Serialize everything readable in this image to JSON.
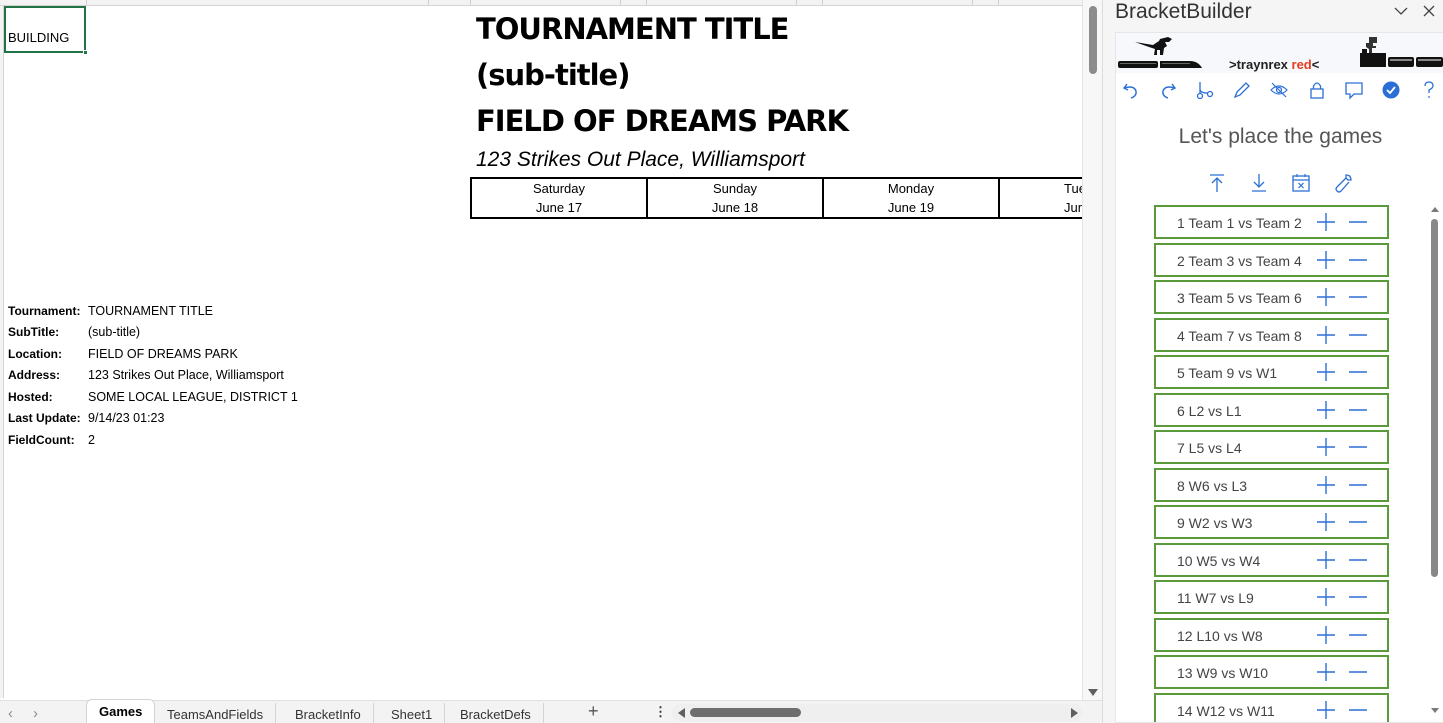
{
  "sheet": {
    "selected_cell_value": "BUILDING",
    "titles": {
      "tournament": "TOURNAMENT TITLE",
      "subtitle": "(sub-title)",
      "location": "FIELD OF DREAMS PARK",
      "address": "123 Strikes Out Place, Williamsport"
    },
    "days": [
      {
        "day": "Saturday",
        "date": "June 17"
      },
      {
        "day": "Sunday",
        "date": "June 18"
      },
      {
        "day": "Monday",
        "date": "June 19"
      },
      {
        "day": "Tue",
        "date": "Jur"
      }
    ],
    "info": [
      {
        "label": "Tournament:",
        "value": "TOURNAMENT TITLE"
      },
      {
        "label": "SubTitle:",
        "value": "(sub-title)"
      },
      {
        "label": "Location:",
        "value": "FIELD OF DREAMS PARK"
      },
      {
        "label": "Address:",
        "value": "123 Strikes Out Place, Williamsport"
      },
      {
        "label": "Hosted:",
        "value": "SOME LOCAL LEAGUE, DISTRICT 1"
      },
      {
        "label": "Last Update:",
        "value": "9/14/23 01:23"
      },
      {
        "label": "FieldCount:",
        "value": "2"
      }
    ]
  },
  "tabs": {
    "prev": "‹",
    "next": "›",
    "items": [
      "Games",
      "TeamsAndFields",
      "BracketInfo",
      "Sheet1",
      "BracketDefs"
    ],
    "active": "Games",
    "add": "+",
    "more": "⋮"
  },
  "pane": {
    "title": "BracketBuilder",
    "collapse_icon": "chevron-down-icon",
    "close_icon": "close-icon",
    "brand_prefix": ">traynrex ",
    "brand_red": "red",
    "brand_suffix": "<",
    "brand_red_color": "#e53b1f",
    "toolbar_icons": [
      "undo-icon",
      "redo-icon",
      "branch-icon",
      "pen-icon",
      "hide-icon",
      "lock-icon",
      "comment-icon",
      "check-circle-icon",
      "help-icon"
    ],
    "heading": "Let's place the games",
    "action_icons": [
      "move-top-icon",
      "download-icon",
      "calendar-clear-icon",
      "wrench-icon"
    ],
    "accent": "#2b6fd6",
    "item_border": "#5b9a3a",
    "games": [
      "1  Team 1 vs Team 2",
      "2  Team 3 vs Team 4",
      "3  Team 5 vs Team 6",
      "4  Team 7 vs Team 8",
      "5  Team 9 vs W1",
      "6  L2 vs L1",
      "7  L5 vs L4",
      "8  W6 vs L3",
      "9  W2 vs W3",
      "10  W5 vs W4",
      "11  W7 vs L9",
      "12  L10 vs W8",
      "13  W9 vs W10",
      "14  W12 vs W11"
    ]
  }
}
